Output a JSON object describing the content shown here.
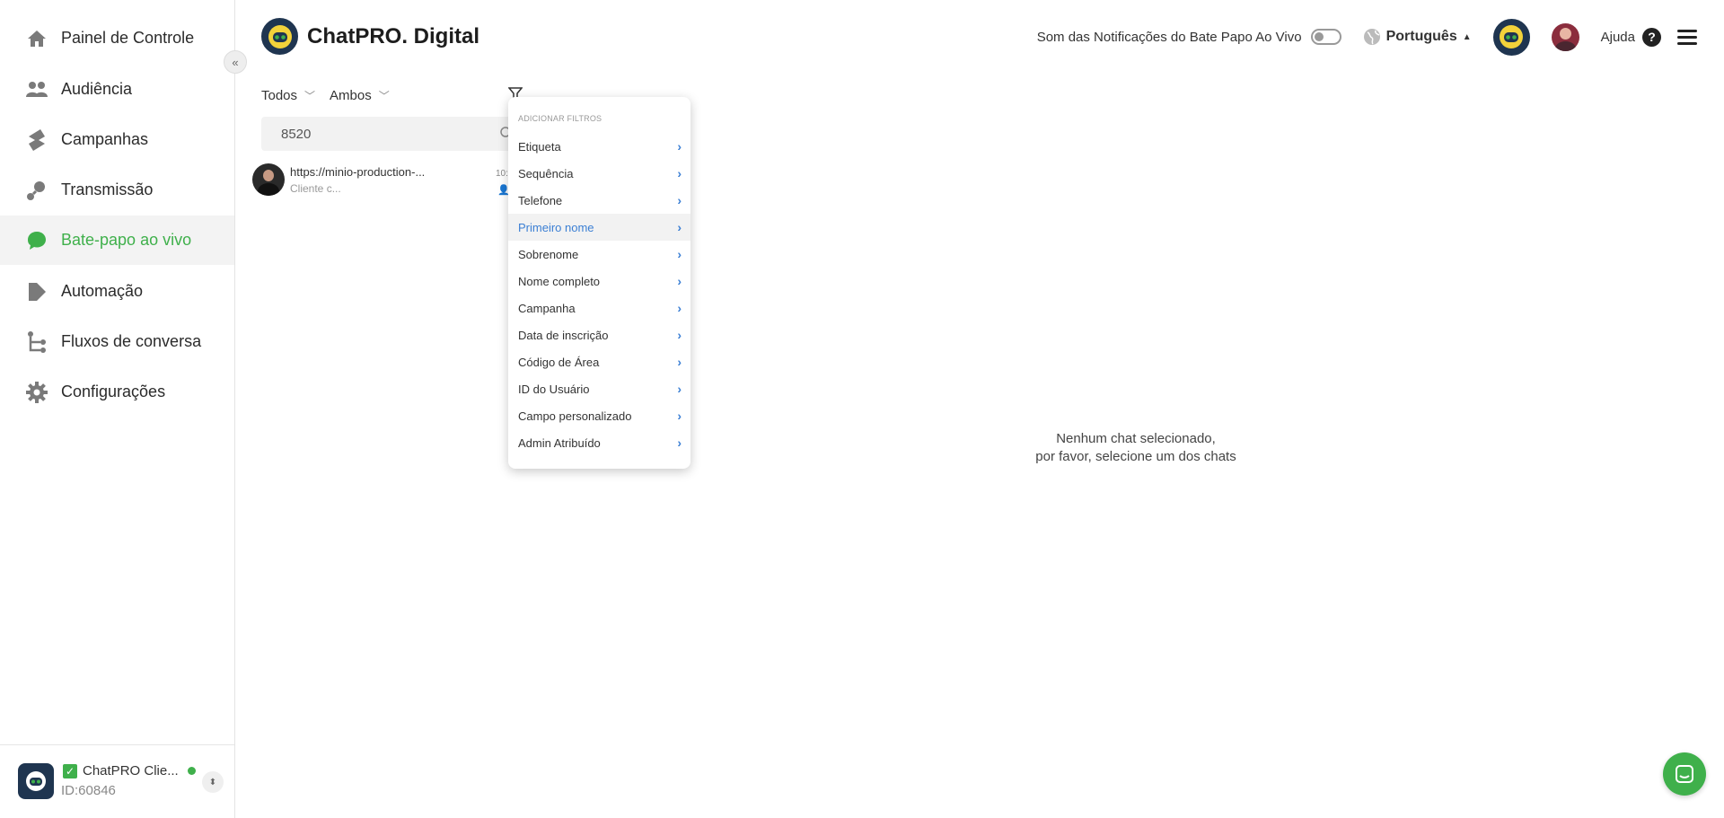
{
  "sidebar": {
    "items": [
      {
        "label": "Painel de Controle",
        "icon": "home-icon"
      },
      {
        "label": "Audiência",
        "icon": "users-icon"
      },
      {
        "label": "Campanhas",
        "icon": "campaign-icon"
      },
      {
        "label": "Transmissão",
        "icon": "broadcast-icon"
      },
      {
        "label": "Bate-papo ao vivo",
        "icon": "chat-bubble-icon",
        "active": true
      },
      {
        "label": "Automação",
        "icon": "automation-icon"
      },
      {
        "label": "Fluxos de conversa",
        "icon": "flow-icon"
      },
      {
        "label": "Configurações",
        "icon": "gear-icon"
      }
    ],
    "collapse_label": "«",
    "account": {
      "name": "ChatPRO Clie...",
      "id": "ID:60846"
    }
  },
  "header": {
    "brand": "ChatPRO. Digital",
    "notif_label": "Som das Notificações do Bate Papo Ao Vivo",
    "language": "Português",
    "help_label": "Ajuda"
  },
  "chatlist": {
    "filter_all": "Todos",
    "filter_both": "Ambos",
    "search_value": "8520",
    "chats": [
      {
        "title": "https://minio-production-...",
        "subtitle": "Cliente c...",
        "time": "10:"
      }
    ]
  },
  "dropdown": {
    "header": "ADICIONAR FILTROS",
    "items": [
      "Etiqueta",
      "Sequência",
      "Telefone",
      "Primeiro nome",
      "Sobrenome",
      "Nome completo",
      "Campanha",
      "Data de inscrição",
      "Código de Área",
      "ID do Usuário",
      "Campo personalizado",
      "Admin Atribuído"
    ],
    "highlighted": "Primeiro nome"
  },
  "empty_state": {
    "line1": "Nenhum chat selecionado,",
    "line2": "por favor, selecione um dos chats"
  },
  "colors": {
    "accent": "#3fb04b",
    "link": "#3b7fd4",
    "brand_dark": "#1f3550"
  }
}
